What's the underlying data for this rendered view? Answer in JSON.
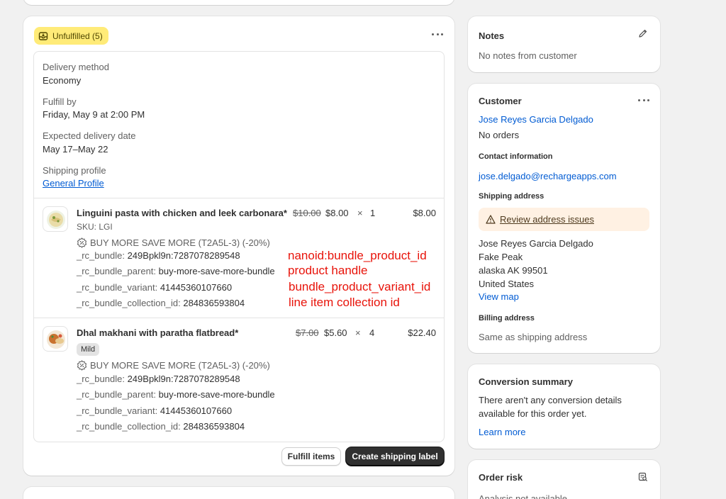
{
  "fulfillment": {
    "badge": "Unfulfilled (5)",
    "delivery_method_label": "Delivery method",
    "delivery_method_value": "Economy",
    "fulfill_by_label": "Fulfill by",
    "fulfill_by_value": "Friday, May 9 at 2:00 PM",
    "expected_delivery_label": "Expected delivery date",
    "expected_delivery_value": "May 17–May 22",
    "shipping_profile_label": "Shipping profile",
    "shipping_profile_link": "General Profile",
    "items": [
      {
        "title": "Linguini pasta with chicken and leek carbonara*",
        "sku": "SKU: LGI",
        "discount": "BUY MORE SAVE MORE (T2A5L-3) (-20%)",
        "props": [
          {
            "key": "_rc_bundle:",
            "value": "249Bpkl9n:7287078289548"
          },
          {
            "key": "_rc_bundle_parent:",
            "value": "buy-more-save-more-bundle"
          },
          {
            "key": "_rc_bundle_variant:",
            "value": "41445360107660"
          },
          {
            "key": "_rc_bundle_collection_id:",
            "value": "284836593804"
          }
        ],
        "original_price": "$10.00",
        "price": "$8.00",
        "times": "×",
        "qty": "1",
        "total": "$8.00"
      },
      {
        "title": "Dhal makhani with paratha flatbread*",
        "variant": "Mild",
        "discount": "BUY MORE SAVE MORE (T2A5L-3) (-20%)",
        "props": [
          {
            "key": "_rc_bundle:",
            "value": "249Bpkl9n:7287078289548"
          },
          {
            "key": "_rc_bundle_parent:",
            "value": "buy-more-save-more-bundle"
          },
          {
            "key": "_rc_bundle_variant:",
            "value": "41445360107660"
          },
          {
            "key": "_rc_bundle_collection_id:",
            "value": "284836593804"
          }
        ],
        "original_price": "$7.00",
        "price": "$5.60",
        "times": "×",
        "qty": "4",
        "total": "$22.40"
      }
    ],
    "annotations": [
      "nanoid:bundle_product_id",
      "product handle",
      "bundle_product_variant_id",
      "line item collection id"
    ],
    "fulfill_button": "Fulfill items",
    "shipping_label_button": "Create shipping label"
  },
  "notes": {
    "title": "Notes",
    "text": "No notes from customer"
  },
  "customer": {
    "title": "Customer",
    "name": "Jose Reyes Garcia Delgado",
    "orders": "No orders",
    "contact_title": "Contact information",
    "email": "jose.delgado@rechargeapps.com",
    "shipping_title": "Shipping address",
    "review_link": "Review address issues",
    "address": [
      "Jose Reyes Garcia Delgado",
      "Fake Peak",
      "alaska AK 99501",
      "United States"
    ],
    "view_map": "View map",
    "billing_title": "Billing address",
    "billing_text": "Same as shipping address"
  },
  "conversion": {
    "title": "Conversion summary",
    "text_line1": "There aren't any conversion details",
    "text_line2": "available for this order yet.",
    "learn_more": "Learn more"
  },
  "risk": {
    "title": "Order risk",
    "text": "Analysis not available"
  },
  "colors": {
    "badge_bg": "#ffeb78",
    "link": "#005bd3",
    "annotation": "#e8130a",
    "warning_bg": "#fff1e3"
  }
}
